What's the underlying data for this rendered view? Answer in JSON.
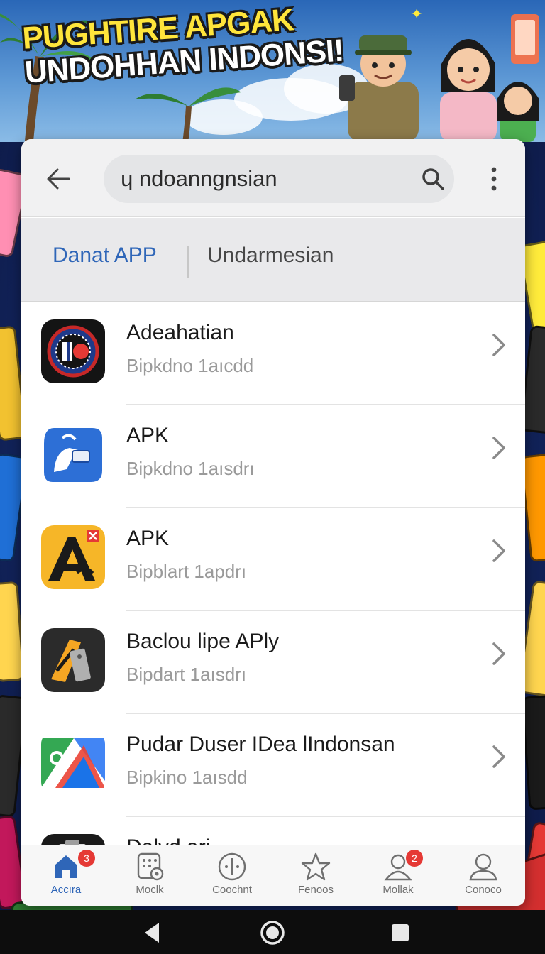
{
  "banner": {
    "line1": "PUGHTIRE APGAK",
    "line2": "UNDOHHAN INDONSI!"
  },
  "search": {
    "value": "ɥ ndoanngnsian"
  },
  "icons": {
    "back": "arrow-left-icon",
    "search": "search-icon",
    "more": "more-vert-icon",
    "chevron": "chevron-right-icon"
  },
  "tabs": [
    {
      "label": "Danat APP",
      "active": true
    },
    {
      "label": "Undarmesian",
      "active": false
    }
  ],
  "apps": [
    {
      "title": "Adeahatian",
      "subtitle": "Bipkdno 1aıcdd",
      "icon": "circle-emblem-app-icon"
    },
    {
      "title": "APK",
      "subtitle": "Bipkdno 1aısdrı",
      "icon": "hand-card-app-icon"
    },
    {
      "title": "APK",
      "subtitle": "Bipblart 1apdrı",
      "icon": "letter-a-app-icon"
    },
    {
      "title": "Baclou lipe APly",
      "subtitle": "Bipdart 1aısdrı",
      "icon": "tool-app-icon"
    },
    {
      "title": "Pudar Duser IDea lIndonsan",
      "subtitle": "Bipkino 1aısdd",
      "icon": "shapes-app-icon"
    },
    {
      "title": "Dalvd ari",
      "subtitle": "",
      "icon": "clipboard-app-icon"
    }
  ],
  "bottom_nav": [
    {
      "label": "Accıra",
      "icon": "home-icon",
      "badge": "3",
      "active": true
    },
    {
      "label": "Moclk",
      "icon": "grid-gear-icon",
      "badge": "",
      "active": false
    },
    {
      "label": "Coochnt",
      "icon": "circle-dots-icon",
      "badge": "",
      "active": false
    },
    {
      "label": "Fenoos",
      "icon": "star-icon",
      "badge": "",
      "active": false
    },
    {
      "label": "Mollak",
      "icon": "person-icon",
      "badge": "2",
      "active": false
    },
    {
      "label": "Conoco",
      "icon": "person-outline-icon",
      "badge": "",
      "active": false
    }
  ],
  "colors": {
    "accent": "#2f66b8",
    "badge": "#e53935",
    "title_yellow": "#ffe53b",
    "background_navy": "#14204e"
  }
}
